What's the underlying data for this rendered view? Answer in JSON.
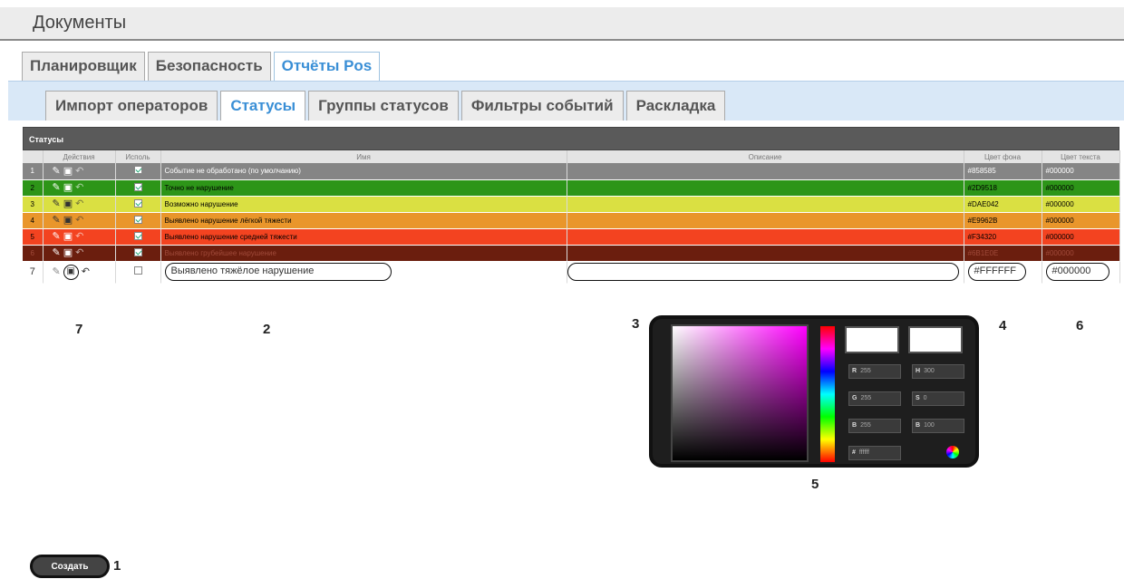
{
  "page_title": "Документы",
  "top_tabs": [
    "Планировщик",
    "Безопасность",
    "Отчёты Pos"
  ],
  "sub_tabs": [
    "Импорт операторов",
    "Статусы",
    "Группы статусов",
    "Фильтры событий",
    "Раскладка"
  ],
  "grid": {
    "caption": "Статусы",
    "columns": [
      "",
      "Действия",
      "Исполь",
      "Имя",
      "Описание",
      "Цвет фона",
      "Цвет текста"
    ],
    "rows": [
      {
        "num": "1",
        "name": "Событие не обработано (по умолчанию)",
        "desc": "",
        "bg": "#858585",
        "fg": "#000000",
        "text_color": "#000000"
      },
      {
        "num": "2",
        "name": "Точно не нарушение",
        "desc": "",
        "bg": "#2D9518",
        "fg": "#000000",
        "text_color": "#000000"
      },
      {
        "num": "3",
        "name": "Возможно нарушение",
        "desc": "",
        "bg": "#DAE042",
        "fg": "#000000",
        "text_color": "#000000"
      },
      {
        "num": "4",
        "name": "Выявлено нарушение лёгкой тяжести",
        "desc": "",
        "bg": "#E9962B",
        "fg": "#000000",
        "text_color": "#000000"
      },
      {
        "num": "5",
        "name": "Выявлено нарушение средней тяжести",
        "desc": "",
        "bg": "#F34320",
        "fg": "#000000",
        "text_color": "#000000"
      },
      {
        "num": "6",
        "name": "Выявлено грубейшее нарушение",
        "desc": "",
        "bg": "#6B1E0E",
        "fg": "#000000",
        "text_color": "#000000"
      }
    ],
    "edit_row": {
      "num": "7",
      "name": "Выявлено тяжёлое нарушение",
      "desc": "",
      "bg": "#FFFFFF",
      "fg": "#000000"
    }
  },
  "picker": {
    "r_label": "R",
    "r": "255",
    "g_label": "G",
    "g": "255",
    "b_label": "B",
    "b": "255",
    "h_label": "H",
    "h": "300",
    "s_label": "S",
    "s": "0",
    "v_label": "B",
    "v": "100",
    "hex_label": "#",
    "hex": "ffffff"
  },
  "callouts": {
    "c1": "1",
    "c2": "2",
    "c3": "3",
    "c4": "4",
    "c5": "5",
    "c6": "6",
    "c7": "7"
  },
  "create_label": "Создать"
}
